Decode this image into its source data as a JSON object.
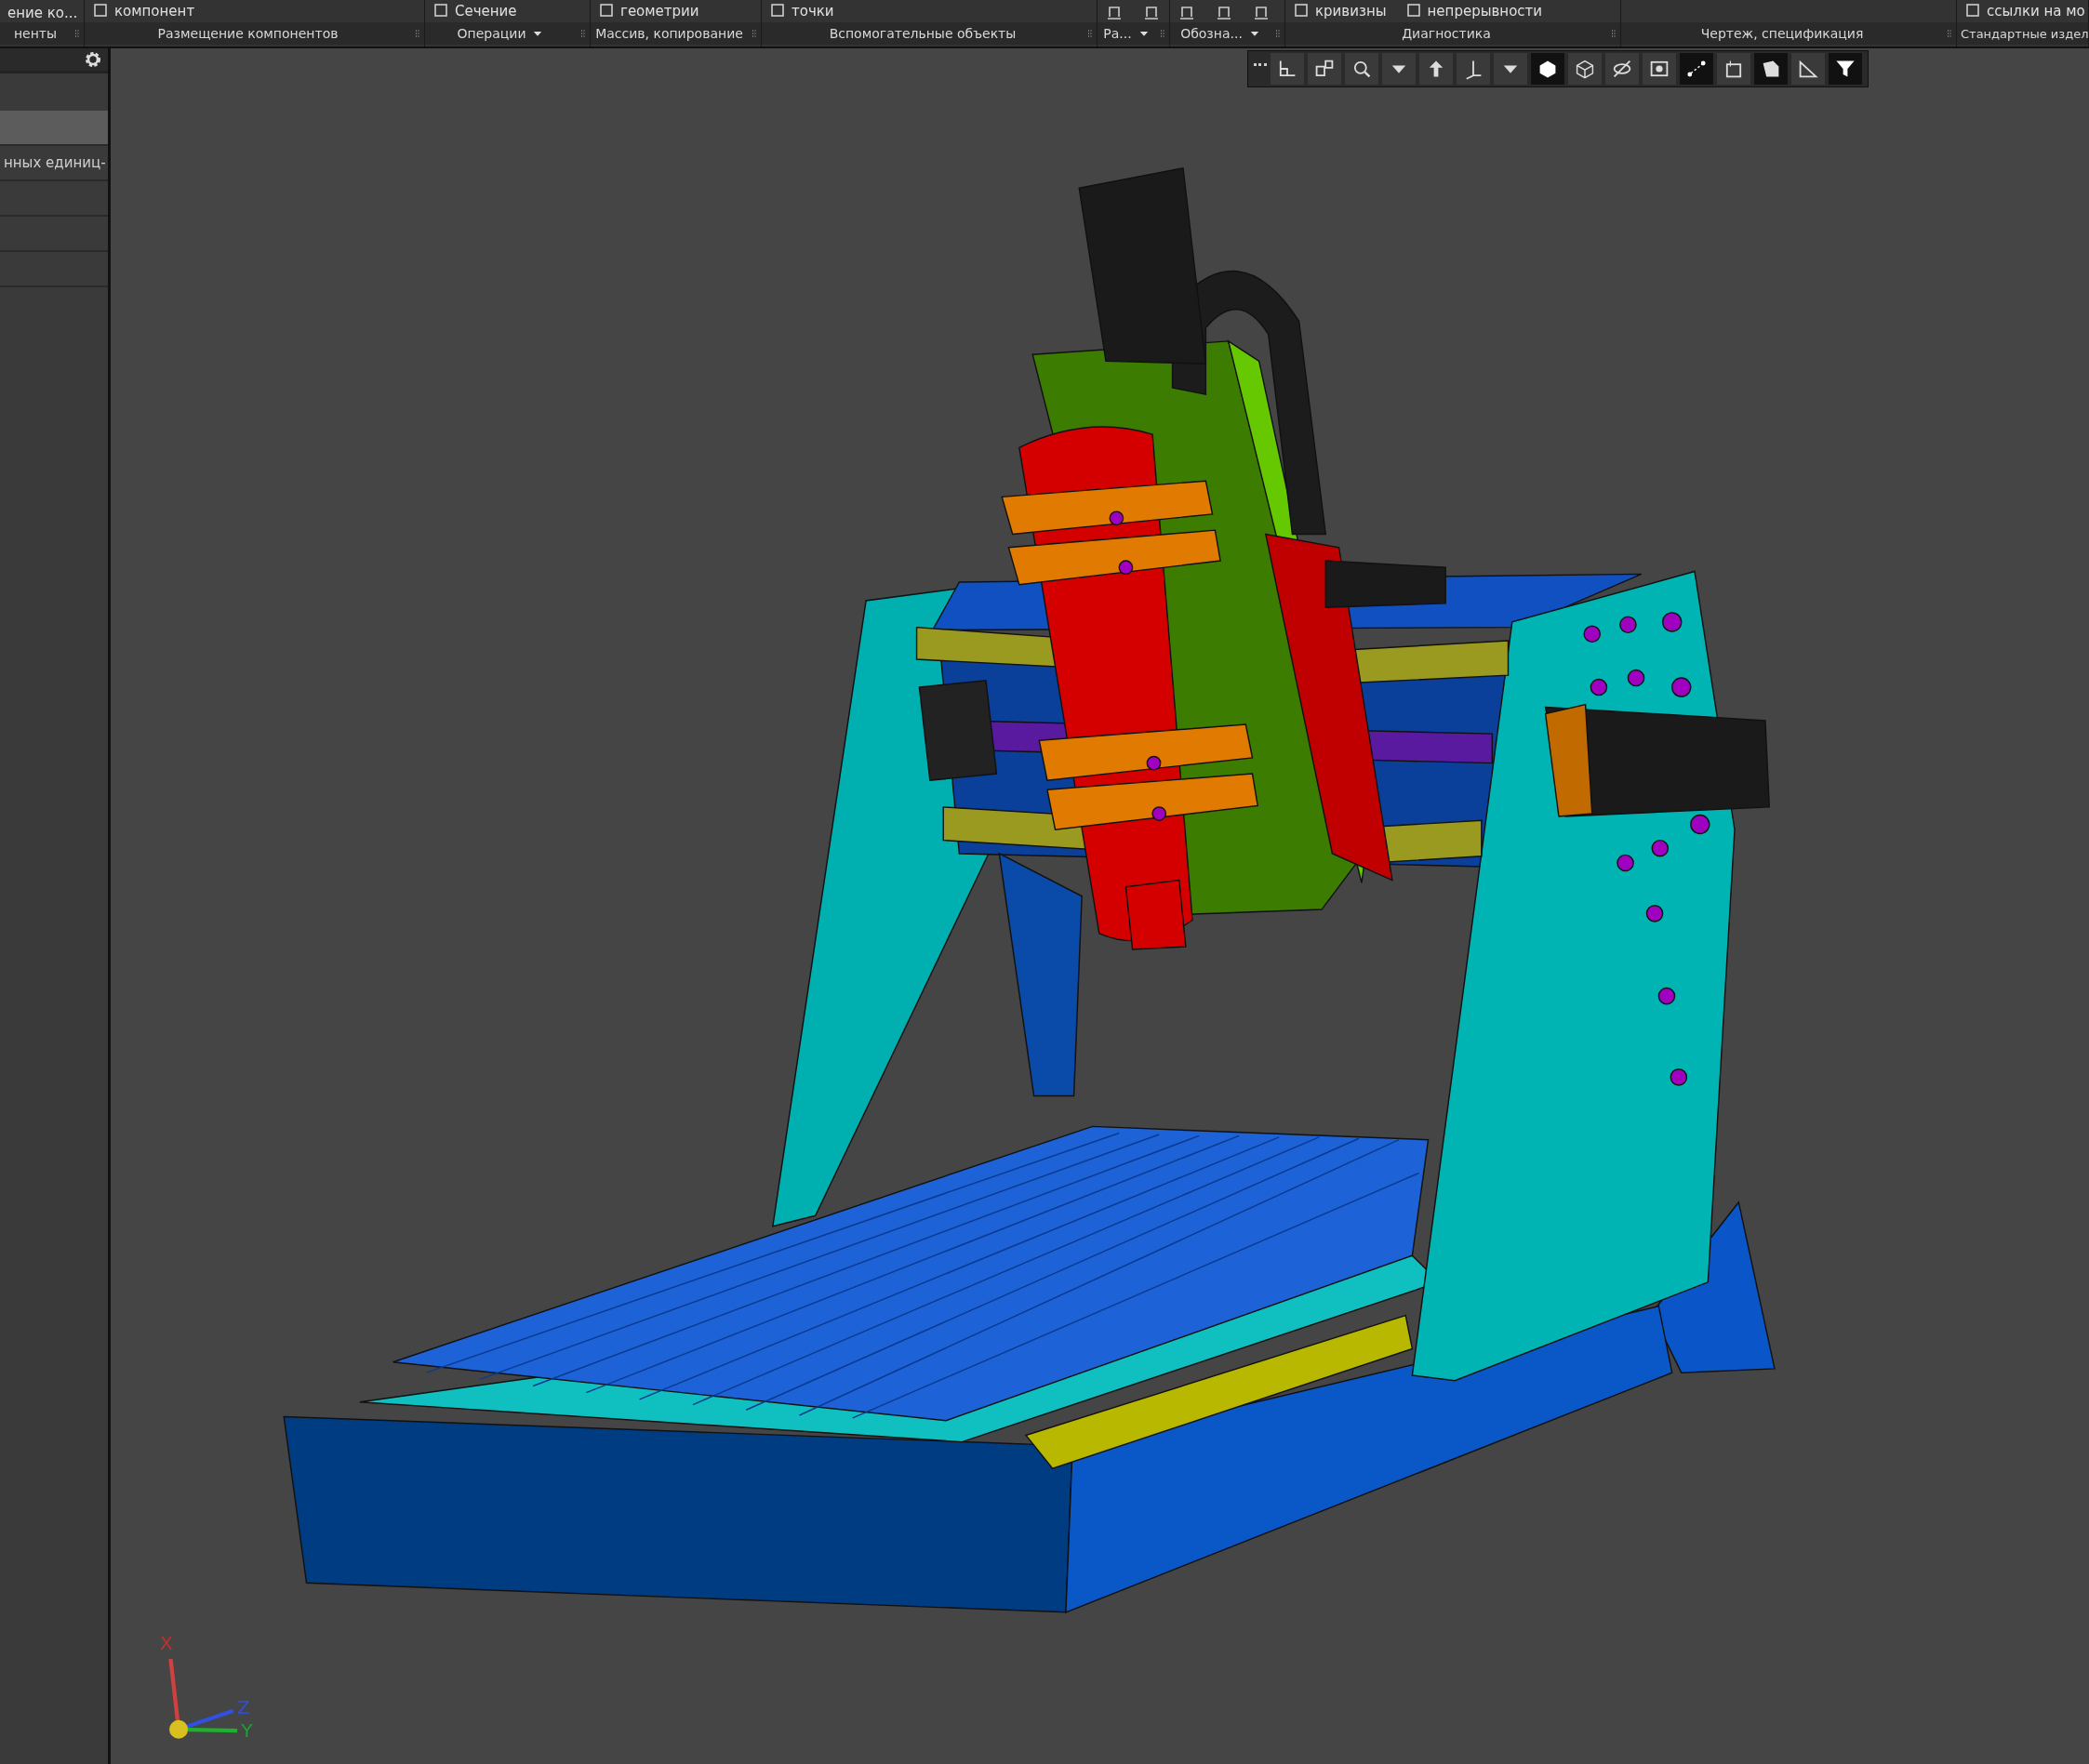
{
  "ribbon": {
    "groups": [
      {
        "title": "ненты",
        "items": [
          {
            "label": "ение ко..."
          }
        ]
      },
      {
        "title": "Размещение компонентов",
        "items": [
          {
            "label": "компонент"
          }
        ]
      },
      {
        "title": "Операции",
        "items": [
          {
            "label": "Сечение"
          }
        ],
        "dropdown": true
      },
      {
        "title": "Массив, копирование",
        "items": [
          {
            "label": "геометрии"
          }
        ]
      },
      {
        "title": "Вспомогательные объекты",
        "items": [
          {
            "label": "точки"
          }
        ]
      },
      {
        "title": "Ра...",
        "dropdown": true
      },
      {
        "title": "Обозна...",
        "dropdown": true
      },
      {
        "title": "Диагностика",
        "items": [
          {
            "label": "кривизны"
          },
          {
            "label": "непрерывности"
          }
        ]
      },
      {
        "title": "Чертеж, спецификация"
      },
      {
        "title": "Стандартные издел",
        "items": [
          {
            "label": "ссылки на мо"
          }
        ]
      }
    ]
  },
  "tree_panel": {
    "rows": [
      {
        "label": "",
        "selected": true
      },
      {
        "label": "нных единиц-",
        "selected": false
      },
      {
        "label": "",
        "selected": false
      },
      {
        "label": "",
        "selected": false
      },
      {
        "label": "",
        "selected": false
      }
    ]
  },
  "view_toolbar": {
    "buttons": [
      {
        "selected": false
      },
      {
        "selected": false
      },
      {
        "selected": false
      },
      {
        "selected": false
      },
      {
        "selected": false
      },
      {
        "selected": false
      },
      {
        "selected": false
      },
      {
        "selected": true
      },
      {
        "selected": false
      },
      {
        "selected": false
      },
      {
        "selected": false
      },
      {
        "selected": true
      },
      {
        "selected": false
      },
      {
        "selected": true
      },
      {
        "selected": false
      },
      {
        "selected": true
      }
    ]
  },
  "axis_triad": {
    "labels": [
      "X",
      "Z",
      "Y"
    ]
  }
}
